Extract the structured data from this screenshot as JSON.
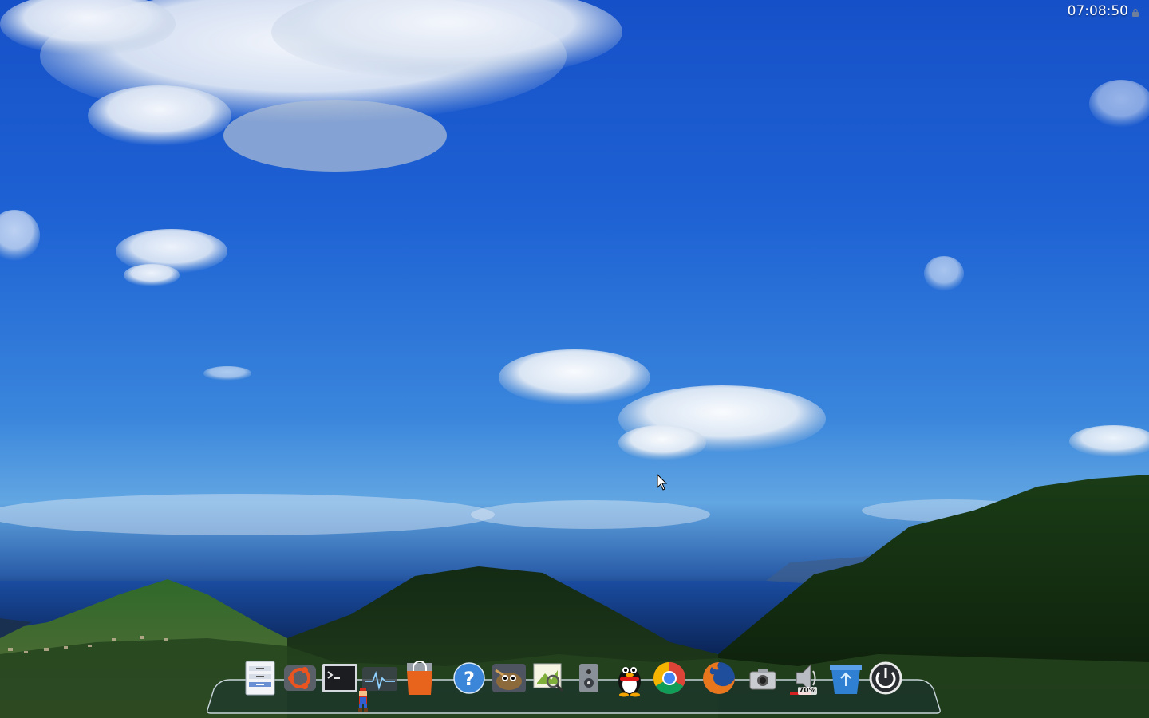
{
  "clock": {
    "time": "07:08:50"
  },
  "dock": {
    "items": [
      {
        "name": "file-manager",
        "icon": "filing-cabinet-icon"
      },
      {
        "name": "ubuntu-software",
        "icon": "ubuntu-logo-icon"
      },
      {
        "name": "terminal",
        "icon": "terminal-icon"
      },
      {
        "name": "system-monitor",
        "icon": "heartbeat-icon"
      },
      {
        "name": "software-center",
        "icon": "shopping-bag-icon"
      },
      {
        "name": "help",
        "icon": "help-icon"
      },
      {
        "name": "gimp",
        "icon": "gimp-icon"
      },
      {
        "name": "image-viewer",
        "icon": "image-viewer-icon"
      },
      {
        "name": "media-player",
        "icon": "speaker-box-icon"
      },
      {
        "name": "qq",
        "icon": "qq-penguin-icon"
      },
      {
        "name": "chrome",
        "icon": "chrome-icon"
      },
      {
        "name": "firefox",
        "icon": "firefox-icon"
      },
      {
        "name": "screenshot",
        "icon": "camera-icon"
      },
      {
        "name": "volume",
        "icon": "speaker-icon"
      },
      {
        "name": "trash",
        "icon": "recycle-bin-icon"
      },
      {
        "name": "shutdown",
        "icon": "power-icon"
      }
    ],
    "volume_level": "70%"
  },
  "colors": {
    "sky_top": "#1650c8",
    "sky_horizon": "#62a6e2",
    "sea": "#0f2f6a",
    "hills": "#1d3a18"
  }
}
